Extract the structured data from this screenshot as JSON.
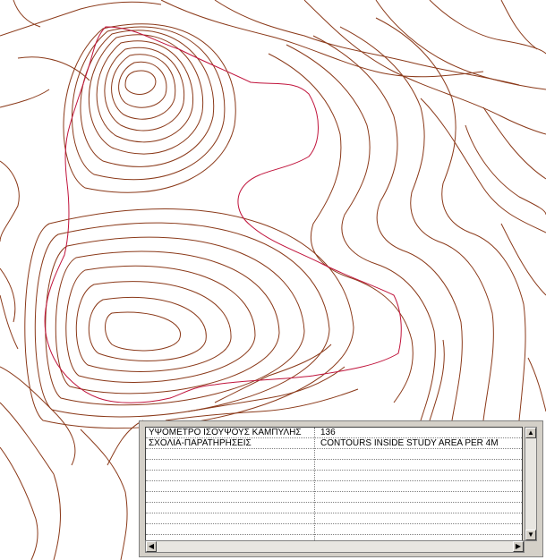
{
  "map": {
    "contour_color": "#8b3a1a",
    "highlight_contour_color": "#c0143c",
    "background": "#ffffff"
  },
  "attribute_table": {
    "rows": [
      {
        "field": "ΥΨΟΜΕΤΡΟ ΙΣΟΥΨΟΥΣ ΚΑΜΠΥΛΗΣ",
        "value": "136"
      },
      {
        "field": "ΣΧΟΛΙΑ-ΠΑΡΑΤΗΡΗΣΕΙΣ",
        "value": "CONTOURS INSIDE STUDY AREA PER 4M"
      },
      {
        "field": "",
        "value": ""
      },
      {
        "field": "",
        "value": ""
      },
      {
        "field": "",
        "value": ""
      },
      {
        "field": "",
        "value": ""
      },
      {
        "field": "",
        "value": ""
      },
      {
        "field": "",
        "value": ""
      },
      {
        "field": "",
        "value": ""
      },
      {
        "field": "",
        "value": ""
      }
    ]
  },
  "scrollbars": {
    "up_icon": "triangle-up",
    "down_icon": "triangle-down",
    "left_icon": "triangle-left",
    "right_icon": "triangle-right"
  }
}
